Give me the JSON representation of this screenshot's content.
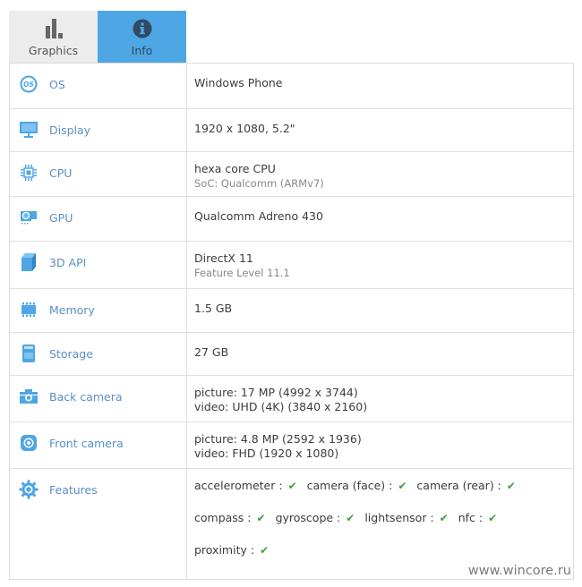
{
  "tabs": [
    {
      "id": "graphics",
      "label": "Graphics",
      "icon": "bar-chart-icon",
      "active": false
    },
    {
      "id": "info",
      "label": "Info",
      "icon": "info-icon",
      "active": true
    }
  ],
  "colors": {
    "active_tab": "#4ea6e4",
    "inactive_tab": "#ececec",
    "label_blue": "#5a8fc8",
    "icon_blue": "#4ea6e4",
    "check_green": "#3aa03a"
  },
  "rows": [
    {
      "label": "OS",
      "icon": "os-icon",
      "value": "Windows Phone"
    },
    {
      "label": "Display",
      "icon": "monitor-icon",
      "value": "1920 x 1080, 5.2\""
    },
    {
      "label": "CPU",
      "icon": "cpu-chip-icon",
      "value": "hexa core CPU",
      "sub": "SoC: Qualcomm (ARMv7)"
    },
    {
      "label": "GPU",
      "icon": "gpu-card-icon",
      "value": "Qualcomm Adreno 430"
    },
    {
      "label": "3D API",
      "icon": "cube-icon",
      "value": "DirectX 11",
      "sub": "Feature Level 11.1"
    },
    {
      "label": "Memory",
      "icon": "memory-icon",
      "value": "1.5 GB"
    },
    {
      "label": "Storage",
      "icon": "sd-card-icon",
      "value": "27 GB"
    },
    {
      "label": "Back camera",
      "icon": "camera-icon",
      "value": "picture: 17 MP (4992 x 3744)",
      "value2": "video: UHD (4K) (3840 x 2160)"
    },
    {
      "label": "Front camera",
      "icon": "front-camera-icon",
      "value": "picture: 4.8 MP (2592 x 1936)",
      "value2": "video: FHD (1920 x 1080)"
    },
    {
      "label": "Features",
      "icon": "gear-icon"
    }
  ],
  "features": [
    [
      {
        "name": "accelerometer :",
        "supported": true
      },
      {
        "name": "camera (face) :",
        "supported": true
      },
      {
        "name": "camera (rear) :",
        "supported": true
      }
    ],
    [
      {
        "name": "compass :",
        "supported": true
      },
      {
        "name": "gyroscope :",
        "supported": true
      },
      {
        "name": "lightsensor :",
        "supported": true
      },
      {
        "name": "nfc :",
        "supported": true
      }
    ],
    [
      {
        "name": "proximity :",
        "supported": true
      }
    ]
  ],
  "check_glyph": "✔",
  "watermark": "www.wincore.ru"
}
